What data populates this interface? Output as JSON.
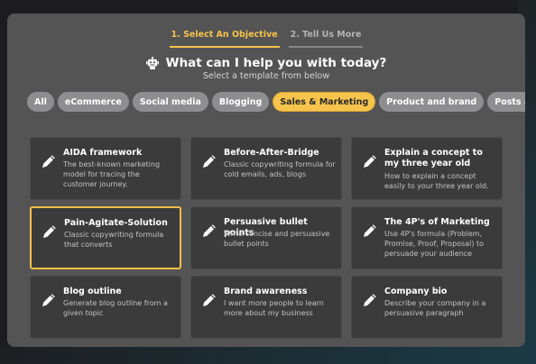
{
  "steps": [
    {
      "label": "1. Select An Objective",
      "active": true
    },
    {
      "label": "2. Tell Us More",
      "active": false
    }
  ],
  "header": {
    "icon": "robot-icon",
    "title": "What can I help you with today?",
    "subtitle": "Select a template from below"
  },
  "categories": [
    {
      "label": "All",
      "active": false
    },
    {
      "label": "eCommerce",
      "active": false
    },
    {
      "label": "Social media",
      "active": false
    },
    {
      "label": "Blogging",
      "active": false
    },
    {
      "label": "Sales & Marketing",
      "active": true
    },
    {
      "label": "Product and brand",
      "active": false
    },
    {
      "label": "Posts & Stories",
      "active": false
    }
  ],
  "templates": [
    {
      "title": "AIDA framework",
      "desc": "The best-known marketing model for tracing the customer journey.",
      "icon": "pencil-icon",
      "selected": false
    },
    {
      "title": "Before-After-Bridge",
      "desc": "Classic copywriting formula for cold emails, ads, blogs",
      "icon": "pencil-icon",
      "selected": false
    },
    {
      "title": "Explain a concept to my three year old",
      "desc": "How to explain a concept easily to your three year old.",
      "icon": "pencil-icon",
      "selected": false
    },
    {
      "title": "Pain-Agitate-Solution",
      "desc": "Classic copywriting formula that converts",
      "icon": "pencil-icon",
      "selected": true
    },
    {
      "title": "Persuasive bullet points",
      "desc": "Write concise and persuasive bullet points",
      "icon": "pencil-icon",
      "selected": false
    },
    {
      "title": "The 4P's of Marketing",
      "desc": "Use 4P's formula (Problem, Promise, Proof, Proposal) to persuade your audience",
      "icon": "pencil-icon",
      "selected": false
    },
    {
      "title": "Blog outline",
      "desc": "Generate blog outline from a given topic",
      "icon": "pencil-icon",
      "selected": false
    },
    {
      "title": "Brand awareness",
      "desc": "I want more people to learn more about my business",
      "icon": "pencil-icon",
      "selected": false
    },
    {
      "title": "Company bio",
      "desc": "Describe your company in a persuasive paragraph",
      "icon": "pencil-icon",
      "selected": false
    }
  ],
  "colors": {
    "accent": "#f6c44d",
    "panel": "#545455",
    "card": "#3b3b3c",
    "chip": "#8e8e90"
  }
}
